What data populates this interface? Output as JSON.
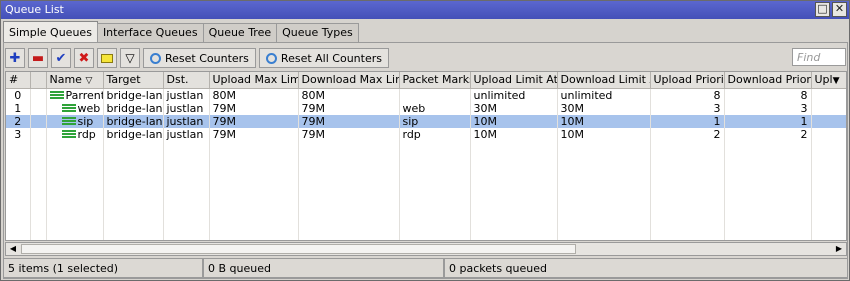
{
  "window": {
    "title": "Queue List"
  },
  "tabs": [
    {
      "label": "Simple Queues",
      "active": true
    },
    {
      "label": "Interface Queues"
    },
    {
      "label": "Queue Tree"
    },
    {
      "label": "Queue Types"
    }
  ],
  "toolbar": {
    "reset_counters": "Reset Counters",
    "reset_all_counters": "Reset All Counters",
    "find_placeholder": "Find"
  },
  "columns": [
    "#",
    "Name",
    "Target",
    "Dst.",
    "Upload Max Limit",
    "Download Max Limit",
    "Packet Marks",
    "Upload Limit At",
    "Download Limit At",
    "Upload Priority",
    "Download Priority",
    "Upl"
  ],
  "rows": [
    {
      "id": "0",
      "name": "Parrent",
      "target": "bridge-lan",
      "dst": "justlan",
      "up_max": "80M",
      "down_max": "80M",
      "marks": "",
      "up_at": "unlimited",
      "down_at": "unlimited",
      "up_prio": "8",
      "down_prio": "8",
      "selected": false
    },
    {
      "id": "1",
      "name": "web",
      "target": "bridge-lan",
      "dst": "justlan",
      "up_max": "79M",
      "down_max": "79M",
      "marks": "web",
      "up_at": "30M",
      "down_at": "30M",
      "up_prio": "3",
      "down_prio": "3",
      "selected": false
    },
    {
      "id": "2",
      "name": "sip",
      "target": "bridge-lan",
      "dst": "justlan",
      "up_max": "79M",
      "down_max": "79M",
      "marks": "sip",
      "up_at": "10M",
      "down_at": "10M",
      "up_prio": "1",
      "down_prio": "1",
      "selected": true
    },
    {
      "id": "3",
      "name": "rdp",
      "target": "bridge-lan",
      "dst": "justlan",
      "up_max": "79M",
      "down_max": "79M",
      "marks": "rdp",
      "up_at": "10M",
      "down_at": "10M",
      "up_prio": "2",
      "down_prio": "2",
      "selected": false
    }
  ],
  "status": {
    "items": "5 items (1 selected)",
    "queued_bytes": "0 B queued",
    "queued_packets": "0 packets queued"
  },
  "colors": {
    "selected_row": "#a7c3ec",
    "title_bar": "#4f5bc4",
    "queue_icon": "#2fa33a"
  }
}
